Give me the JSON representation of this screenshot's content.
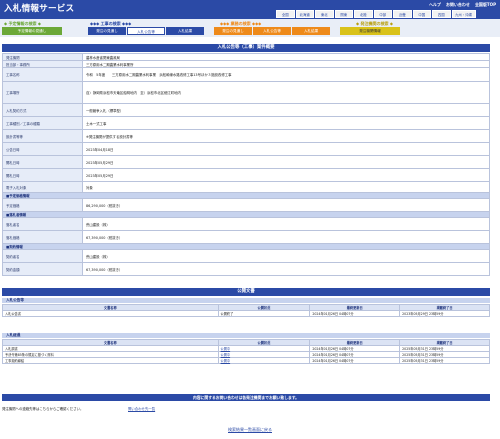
{
  "header": {
    "title": "入札情報サービス",
    "links": [
      "ヘルプ",
      "お問い合わせ",
      "全国版TOP"
    ],
    "regions": [
      "全国",
      "北海道",
      "東北",
      "関東",
      "北陸",
      "中部",
      "近畿",
      "中国",
      "四国",
      "九州・沖縄"
    ]
  },
  "nav": {
    "groups": [
      {
        "label": "◆ 予定情報の検索 ◆",
        "tabs": [
          "予定情報の見通し"
        ]
      },
      {
        "label": "◆◆◆ 工事の検索 ◆◆◆",
        "tabs": [
          "発注の見通し",
          "入札公告等",
          "入札結果"
        ]
      },
      {
        "label": "◆◆◆ 業務の検索 ◆◆◆",
        "tabs": [
          "発注の見通し",
          "入札公告等",
          "入札結果"
        ]
      },
      {
        "label": "◆ 発注機関の検索 ◆",
        "tabs": [
          "発注機関情報"
        ]
      }
    ]
  },
  "main": {
    "title": "入札公告等（工事）案件概要",
    "rows": [
      {
        "k": "発注機関",
        "v": "農林水産省関東農政局"
      },
      {
        "k": "担当部・事務所",
        "v": "三方原用水二期農業水利事業所"
      },
      {
        "k": "工事名称",
        "v": "令和　5年度　　三方原用水二期農業水利事業　浜松幹線水路改修工事13号ほか３施設改修工事"
      },
      {
        "k": "工事場所",
        "v": "自）静岡県浜松市天竜区船明地内　至）浜松市北区細江町地内"
      },
      {
        "k": "入札契約方式",
        "v": "一般競争入札（標準型）"
      },
      {
        "k": "工事種別／工事の種類",
        "v": "土木一式工事"
      },
      {
        "k": "設計書等等",
        "v": "※発注機関が提供する設計書等"
      },
      {
        "k": "公告日時",
        "v": "2023年04月18日"
      },
      {
        "k": "開札日時",
        "v": "2023年05月29日"
      },
      {
        "k": "開札日時",
        "v": "2023年05月29日"
      },
      {
        "k": "電子入札対象",
        "v": "対象"
      }
    ],
    "sections": [
      {
        "title": "■予定価格情報",
        "rows": [
          {
            "k": "予定価格",
            "v": "86,290,000（税抜き）"
          }
        ]
      },
      {
        "title": "■落札者情報",
        "rows": [
          {
            "k": "落札者名",
            "v": "荒山建設（株）"
          },
          {
            "k": "落札価格",
            "v": "67,390,000（税抜き）"
          }
        ]
      },
      {
        "title": "■契約情報",
        "rows": [
          {
            "k": "契約者名",
            "v": "荒山建設（株）"
          },
          {
            "k": "契約金額",
            "v": "67,390,000（税抜き）"
          }
        ]
      }
    ]
  },
  "docs": {
    "title": "公開文書",
    "columns": [
      "文書名称",
      "公開状況",
      "最終更新日",
      "掲載終了日"
    ],
    "kouji": {
      "title": "入札公告等",
      "rows": [
        {
          "name": "入札公告書",
          "status": "公開終了",
          "updated": "2024年01月26日 04時07分",
          "end": "2023年05月29日 23時59分"
        }
      ]
    },
    "kekka": {
      "title": "入札経過",
      "rows": [
        {
          "name": "入札調書",
          "status": "公開中",
          "updated": "2024年01月26日 04時07分",
          "end": "2025年05月31日 23時59分"
        },
        {
          "name": "予決令第85条の規定に基づく資料",
          "status": "公開中",
          "updated": "2024年01月26日 04時07分",
          "end": "2025年05月31日 23時59分"
        },
        {
          "name": "工事契約締結",
          "status": "公開中",
          "updated": "2024年01月26日 04時07分",
          "end": "2025年05月31日 23時59分"
        }
      ]
    }
  },
  "contact": {
    "bar": "内容に関するお問い合わせは各発注機関までお願い致します。",
    "text": "発注機関への連絡先等はこちらからご確認ください。",
    "link": "問い合わせ先一覧"
  },
  "back_link": "検索結果一覧画面に戻る"
}
